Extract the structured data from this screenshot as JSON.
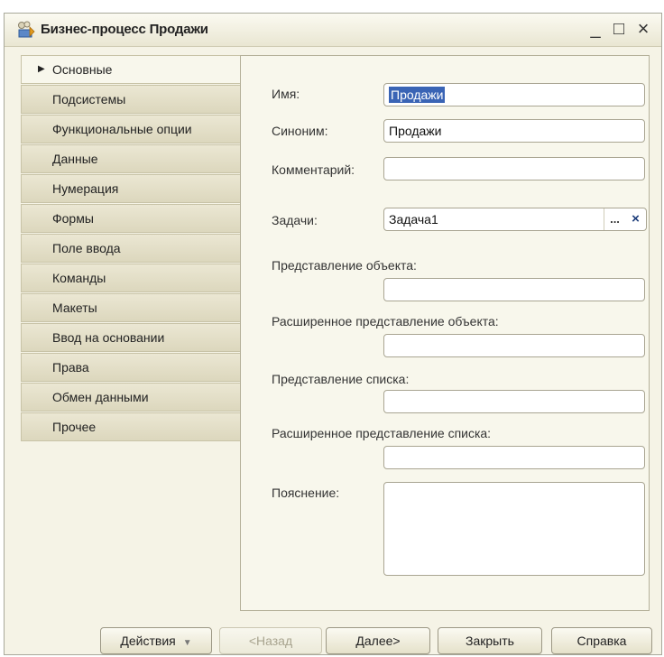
{
  "window": {
    "title": "Бизнес-процесс Продажи",
    "icon": "business-process-icon",
    "controls": {
      "minimize": "_",
      "maximize": "□",
      "close": "×"
    }
  },
  "tabs": [
    {
      "label": "Основные",
      "active": true
    },
    {
      "label": "Подсистемы"
    },
    {
      "label": "Функциональные опции"
    },
    {
      "label": "Данные"
    },
    {
      "label": "Нумерация"
    },
    {
      "label": "Формы"
    },
    {
      "label": "Поле ввода"
    },
    {
      "label": "Команды"
    },
    {
      "label": "Макеты"
    },
    {
      "label": "Ввод на основании"
    },
    {
      "label": "Права"
    },
    {
      "label": "Обмен данными"
    },
    {
      "label": "Прочее"
    }
  ],
  "form": {
    "name": {
      "label": "Имя:",
      "value": "Продажи"
    },
    "synonym": {
      "label": "Синоним:",
      "value": "Продажи"
    },
    "comment": {
      "label": "Комментарий:",
      "value": ""
    },
    "tasks": {
      "label": "Задачи:",
      "value": "Задача1",
      "select_glyph": "...",
      "clear_glyph": "×"
    },
    "object_presentation": {
      "label": "Представление объекта:",
      "value": ""
    },
    "extended_object_presentation": {
      "label": "Расширенное представление объекта:",
      "value": ""
    },
    "list_presentation": {
      "label": "Представление списка:",
      "value": ""
    },
    "extended_list_presentation": {
      "label": "Расширенное представление списка:",
      "value": ""
    },
    "explanation": {
      "label": "Пояснение:",
      "value": ""
    }
  },
  "buttons": {
    "actions": "Действия",
    "back": "<Назад",
    "next": "Далее>",
    "close": "Закрыть",
    "help": "Справка"
  },
  "colors": {
    "background": "#f5f3e6",
    "selection": "#3a64b5"
  }
}
